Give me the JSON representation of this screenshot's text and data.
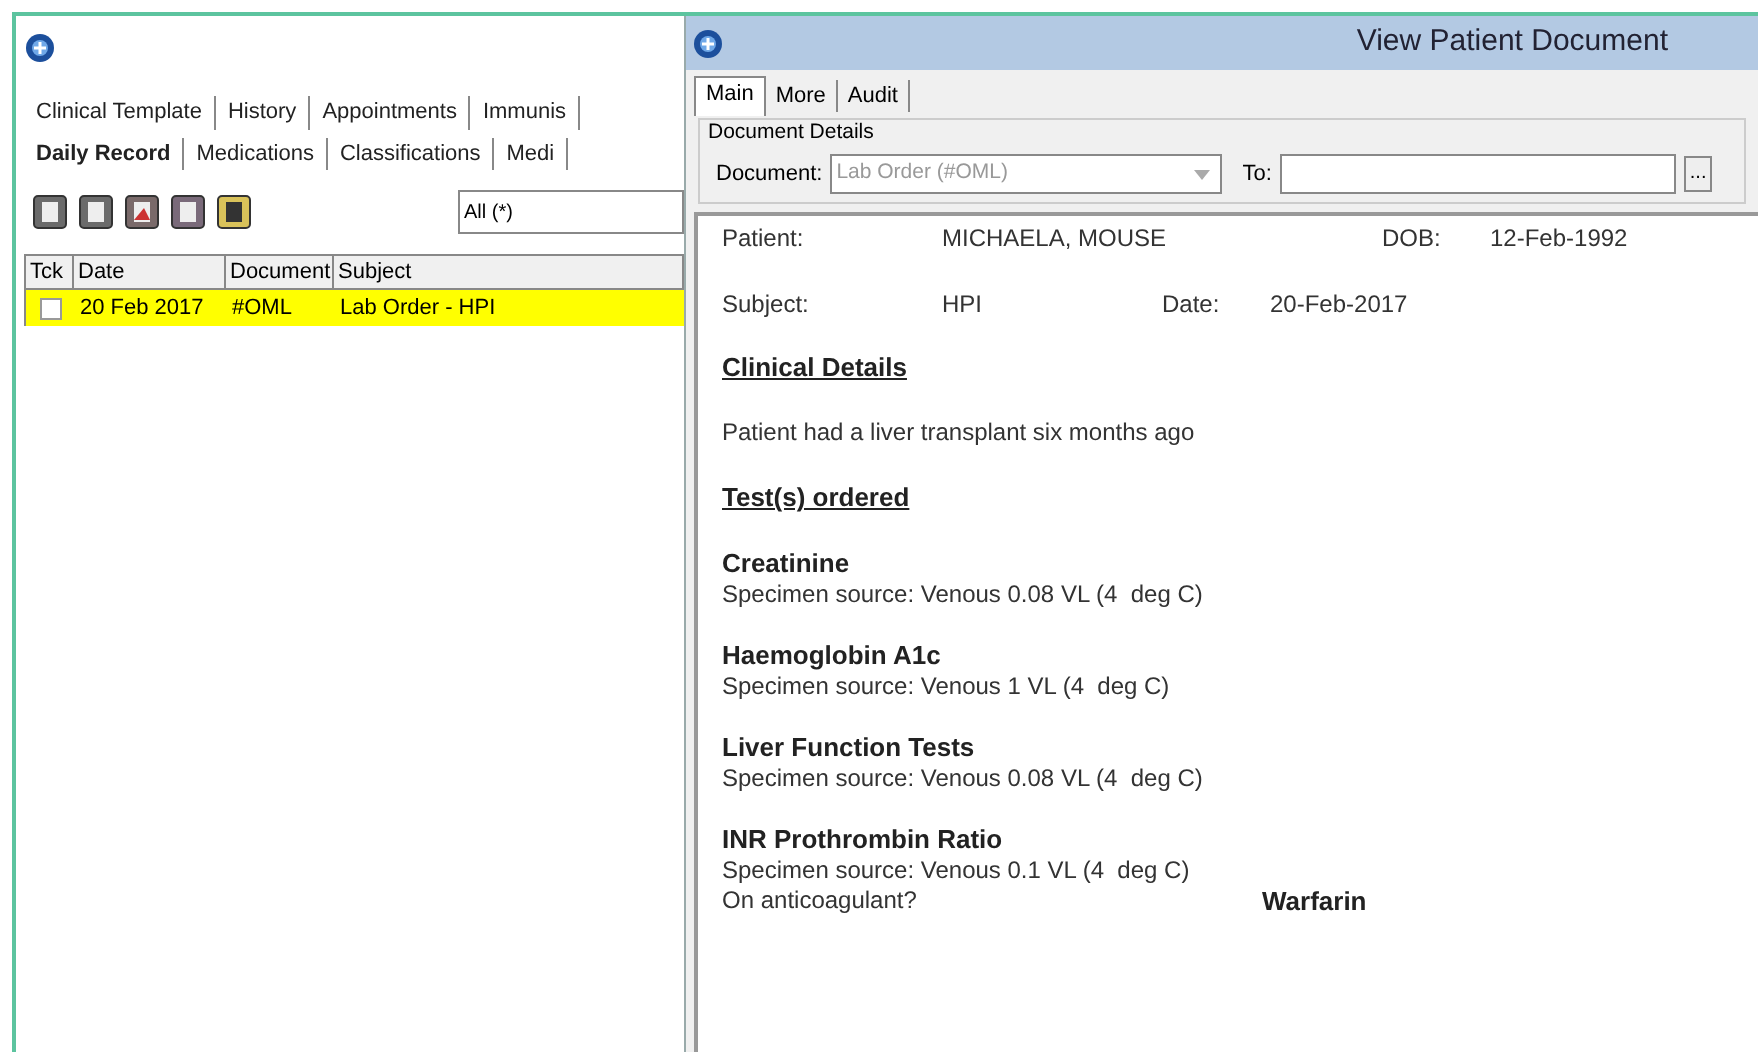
{
  "left_window": {
    "tab_rows": [
      [
        {
          "label": "Clinical Template",
          "selected": false
        },
        {
          "label": "History",
          "selected": false
        },
        {
          "label": "Appointments",
          "selected": false
        },
        {
          "label": "Immunis",
          "selected": false
        }
      ],
      [
        {
          "label": "Daily Record",
          "selected": true
        },
        {
          "label": "Medications",
          "selected": false
        },
        {
          "label": "Classifications",
          "selected": false
        },
        {
          "label": "Medi",
          "selected": false
        }
      ]
    ],
    "filter": {
      "value": "All (*)"
    },
    "table": {
      "check_column": "Tck",
      "columns": [
        "Date",
        "Document",
        "Subject"
      ],
      "rows": [
        {
          "checked": false,
          "selected": true,
          "cells": [
            "20 Feb 2017",
            "#OML",
            "Lab Order - HPI"
          ]
        }
      ]
    }
  },
  "document_window": {
    "title": "View Patient Document",
    "tabs": [
      {
        "label": "Main",
        "selected": true
      },
      {
        "label": "More",
        "selected": false
      },
      {
        "label": "Audit",
        "selected": false
      }
    ],
    "group_label": "Document Details",
    "document_label": "Document:",
    "document_value": "Lab Order (#OML)",
    "to_label": "To:",
    "browse_button": "...",
    "patient_label": "Patient:",
    "patient_value": "MICHAELA, MOUSE",
    "dob_label": "DOB:",
    "dob_value": "12-Feb-1992",
    "subject_label": "Subject:",
    "subject_value": "HPI",
    "date_label": "Date:",
    "date_value": "20-Feb-2017",
    "clinical_heading": "Clinical Details",
    "clinical_text": "Patient had a liver transplant six months ago",
    "tests_heading": "Test(s) ordered",
    "tests": [
      {
        "name": "Creatinine",
        "specimen": "Specimen source: Venous 0.08 VL (4  deg C)"
      },
      {
        "name": "Haemoglobin A1c",
        "specimen": "Specimen source: Venous 1 VL (4  deg C)"
      },
      {
        "name": "Liver Function Tests",
        "specimen": "Specimen source: Venous 0.08 VL (4  deg C)"
      },
      {
        "name": "INR Prothrombin Ratio",
        "specimen": "Specimen source: Venous 0.1 VL (4  deg C)",
        "question": "On anticoagulant?",
        "answer": "Warfarin"
      }
    ]
  }
}
